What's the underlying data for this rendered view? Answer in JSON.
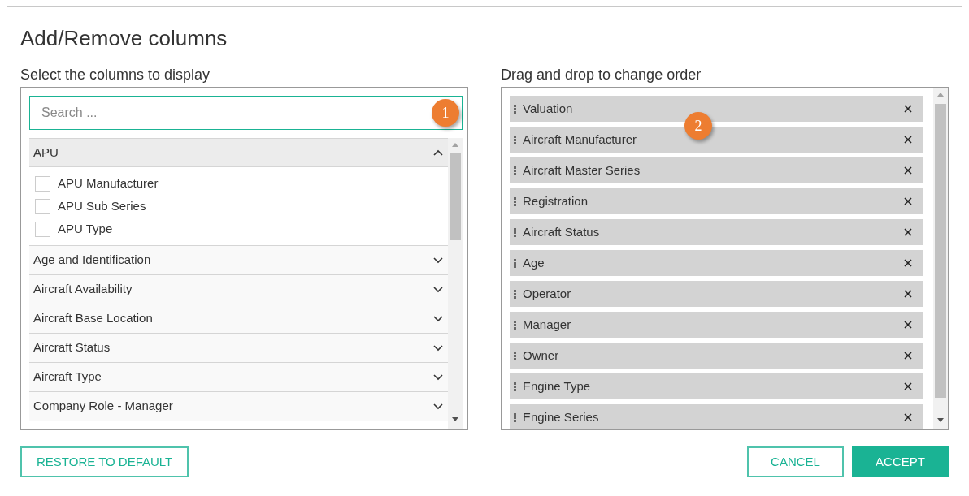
{
  "dialog": {
    "title": "Add/Remove columns"
  },
  "left": {
    "heading": "Select the columns to display",
    "search": {
      "placeholder": "Search ..."
    },
    "groups": [
      {
        "label": "APU",
        "expanded": true,
        "items": [
          {
            "label": "APU Manufacturer",
            "checked": false
          },
          {
            "label": "APU Sub Series",
            "checked": false
          },
          {
            "label": "APU Type",
            "checked": false
          }
        ]
      },
      {
        "label": "Age and Identification",
        "expanded": false
      },
      {
        "label": "Aircraft Availability",
        "expanded": false
      },
      {
        "label": "Aircraft Base Location",
        "expanded": false
      },
      {
        "label": "Aircraft Status",
        "expanded": false
      },
      {
        "label": "Aircraft Type",
        "expanded": false
      },
      {
        "label": "Company Role - Manager",
        "expanded": false
      }
    ]
  },
  "right": {
    "heading": "Drag and drop to change order",
    "columns": [
      "Valuation",
      "Aircraft Manufacturer",
      "Aircraft Master Series",
      "Registration",
      "Aircraft Status",
      "Age",
      "Operator",
      "Manager",
      "Owner",
      "Engine Type",
      "Engine Series"
    ]
  },
  "callouts": [
    "1",
    "2"
  ],
  "buttons": {
    "restore": "RESTORE TO DEFAULT",
    "cancel": "CANCEL",
    "accept": "ACCEPT"
  }
}
